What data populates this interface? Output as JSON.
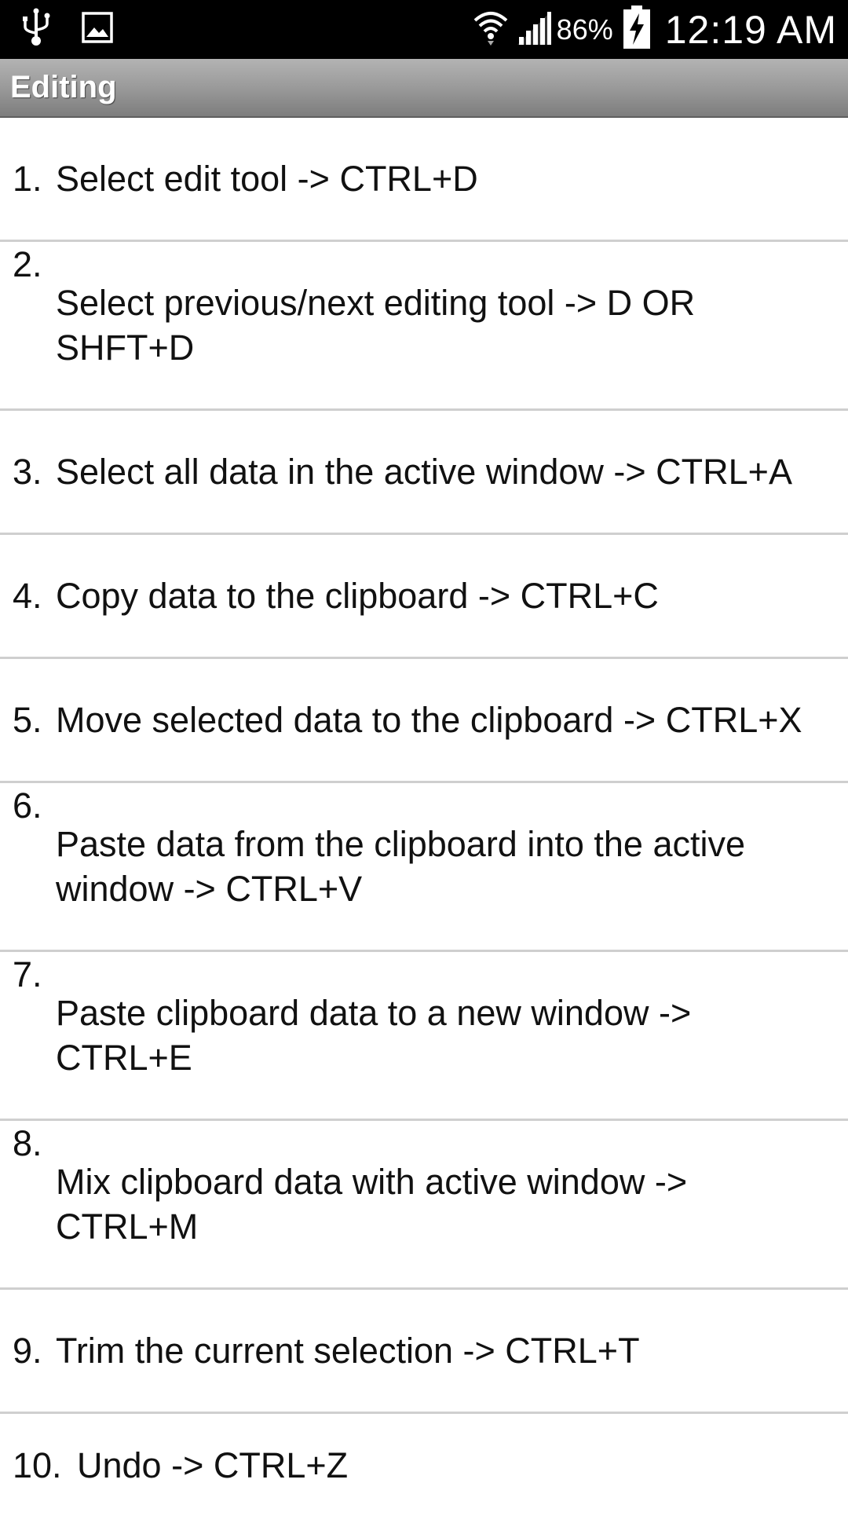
{
  "status_bar": {
    "icons_left": [
      "usb-icon",
      "image-icon"
    ],
    "icons_right": [
      "wifi-icon",
      "signal-icon",
      "battery-charging-icon"
    ],
    "battery": "86%",
    "time": "12:19 AM"
  },
  "title_bar": {
    "title": "Editing"
  },
  "shortcuts": [
    {
      "num": "1.",
      "text": "Select edit tool -> CTRL+D"
    },
    {
      "num": "2.",
      "text": "Select previous/next editing tool -> D OR SHFT+D"
    },
    {
      "num": "3.",
      "text": "Select all data in the active window -> CTRL+A"
    },
    {
      "num": "4.",
      "text": "Copy data to the clipboard -> CTRL+C"
    },
    {
      "num": "5.",
      "text": "Move selected data to the clipboard -> CTRL+X"
    },
    {
      "num": "6.",
      "text": "Paste data from the clipboard into the active window -> CTRL+V"
    },
    {
      "num": "7.",
      "text": "Paste clipboard data to a new window -> CTRL+E"
    },
    {
      "num": "8.",
      "text": "Mix clipboard data with active window -> CTRL+M"
    },
    {
      "num": "9.",
      "text": "Trim the current selection -> CTRL+T"
    },
    {
      "num": "10.",
      "text": "Undo -> CTRL+Z"
    }
  ]
}
